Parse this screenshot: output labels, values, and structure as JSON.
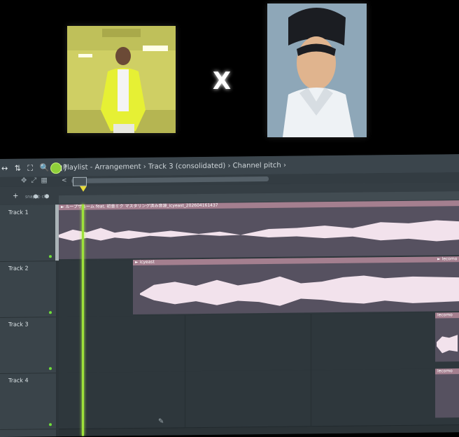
{
  "overlay": {
    "cross": "X"
  },
  "window": {
    "tools": "↔ ⇅ ⛶ 🔍 ◀)",
    "title": "Playlist - Arrangement › Track 3 (consolidated) › Channel pitch ›",
    "nav_left": "<",
    "toolbar_plus": "+",
    "toolbar_small": "snap  ◐  clip"
  },
  "tracks": [
    {
      "label": "Track 1"
    },
    {
      "label": "Track 2"
    },
    {
      "label": "Track 3"
    },
    {
      "label": "Track 4"
    }
  ],
  "clips": {
    "track1": {
      "label": "► ループザルーム feat. 初音ミク マスタリング済み音源_icyeast_202604161437"
    },
    "track2": {
      "label": "► icyeast"
    },
    "track2_end": {
      "label": "► lecomo"
    },
    "track3_end": {
      "label": "lecomo"
    },
    "track4_end": {
      "label": "lecomo"
    }
  },
  "colors": {
    "accent_green": "#9ee13a",
    "clip_header": "#a47f8f",
    "waveform": "#f2e2ec"
  }
}
